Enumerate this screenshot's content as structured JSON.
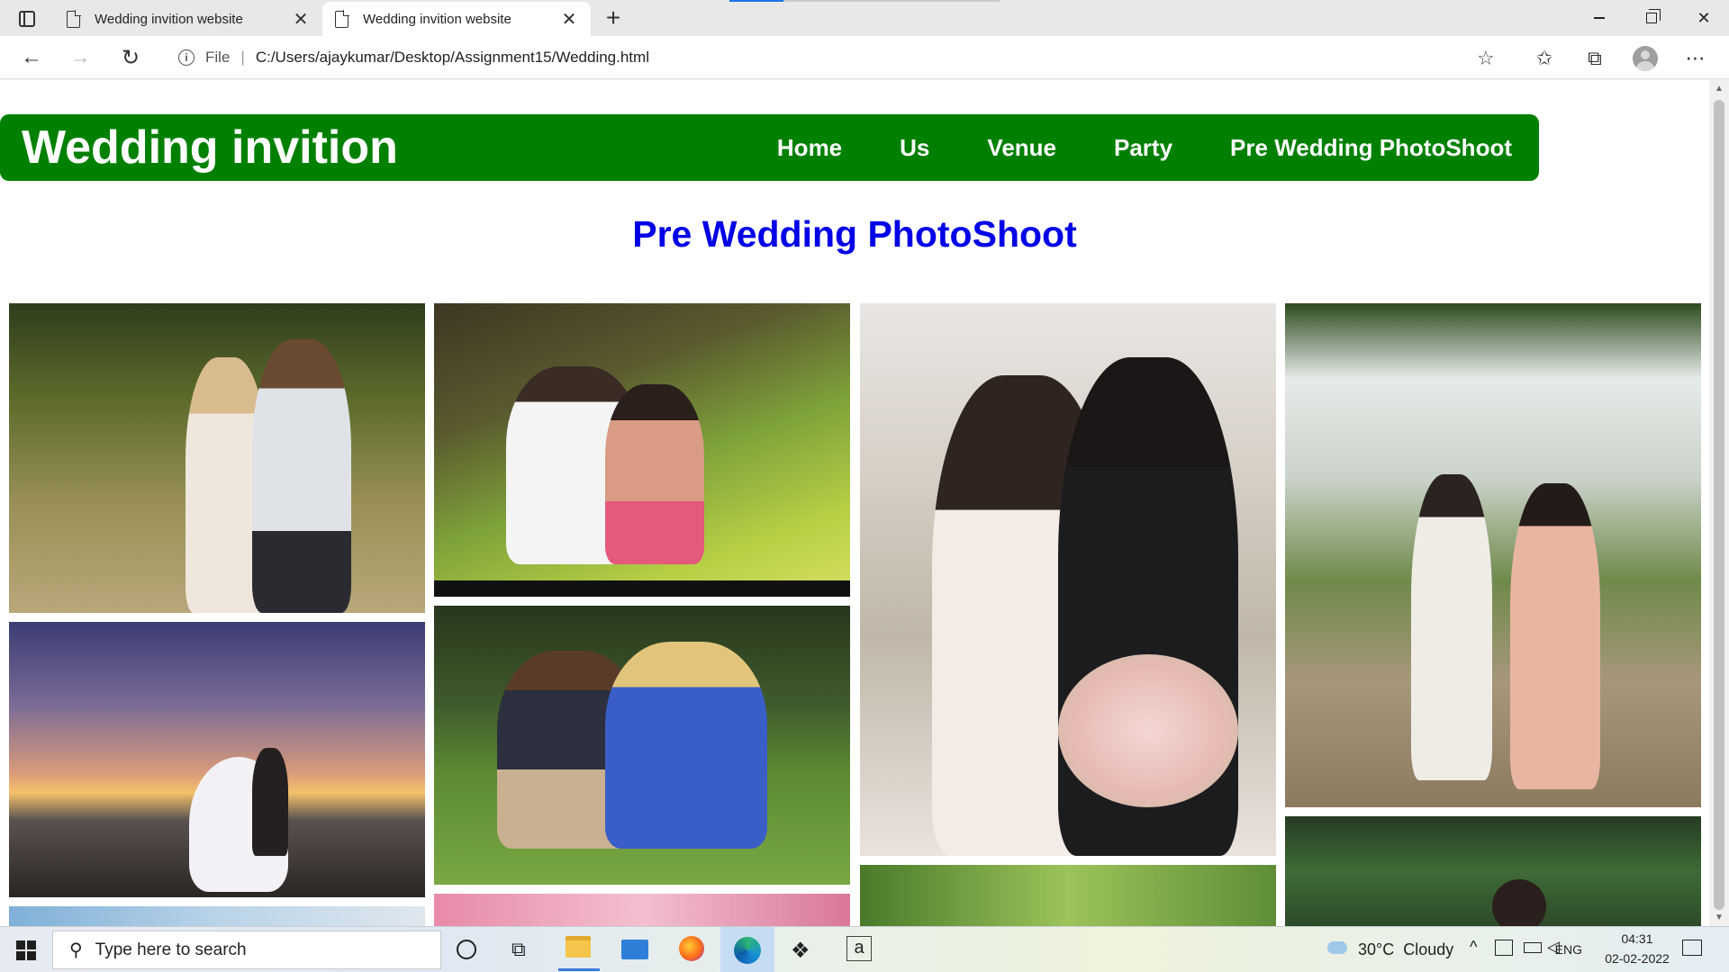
{
  "browser": {
    "tabs": [
      {
        "title": "Wedding invition website",
        "active": false
      },
      {
        "title": "Wedding invition website",
        "active": true
      }
    ],
    "address": {
      "scheme_label": "File",
      "url": "C:/Users/ajaykumar/Desktop/Assignment15/Wedding.html"
    },
    "icons": {
      "back": "back-arrow-icon",
      "forward": "forward-arrow-icon",
      "reload": "reload-icon",
      "favorites": "favorites-icon",
      "collections": "collections-icon",
      "more": "more-icon"
    }
  },
  "site": {
    "brand": "Wedding invition",
    "nav": [
      "Home",
      "Us",
      "Venue",
      "Party",
      "Pre Wedding PhotoShoot"
    ],
    "heading": "Pre Wedding PhotoShoot",
    "colors": {
      "header_bg": "#008000",
      "header_text": "#ffffff",
      "heading_text": "#0000e6"
    }
  },
  "gallery": {
    "photos": [
      {
        "name": "couple-in-field-photo",
        "desc": "couple embracing in tall grass"
      },
      {
        "name": "couple-sitting-grass-photo",
        "desc": "couple sitting on grass under tree"
      },
      {
        "name": "bride-groom-kiss-photo",
        "desc": "bride and groom with bouquet"
      },
      {
        "name": "couple-garden-path-photo",
        "desc": "couple walking on garden path"
      },
      {
        "name": "sunset-couple-photo",
        "desc": "couple on rocks at sunset"
      },
      {
        "name": "couple-lawn-photo",
        "desc": "couple sitting on lawn"
      }
    ]
  },
  "taskbar": {
    "search_placeholder": "Type here to search",
    "weather": "30°C  Cloudy",
    "language": "ENG",
    "time": "04:31",
    "date": "02-02-2022"
  }
}
